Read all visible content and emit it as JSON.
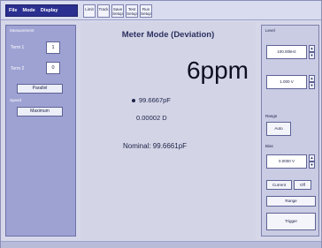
{
  "menu": {
    "items": [
      "File",
      "Mode",
      "Display"
    ]
  },
  "toolbar": {
    "buttons": [
      "Limit",
      "Track",
      "Save Setup",
      "Test Setup",
      "Run Setup"
    ]
  },
  "measurement": {
    "title": "Measurement",
    "term1_label": "Term 1",
    "term1_value": "1",
    "term2_label": "Term 2",
    "term2_value": "0",
    "parallel_button": "Parallel",
    "speed_label": "Speed",
    "speed_value": "Maximum"
  },
  "display": {
    "title": "Meter Mode (Deviation)",
    "deviation": "6ppm",
    "capacitance": "99.6667pF",
    "dissipation": "0.00002 D",
    "nominal": "Nominal: 99.6661pF"
  },
  "right_panel": {
    "group1_label": "Level",
    "freq_value": "100.00kHz",
    "level_value": "1.000 V",
    "range_label": "Range",
    "range_value": "Auto",
    "bias_label": "Bias",
    "bias_value": "0.0000 V",
    "current_button": "Current",
    "off_button": "Off",
    "range_button": "Range",
    "trigger_button": "Trigger"
  }
}
